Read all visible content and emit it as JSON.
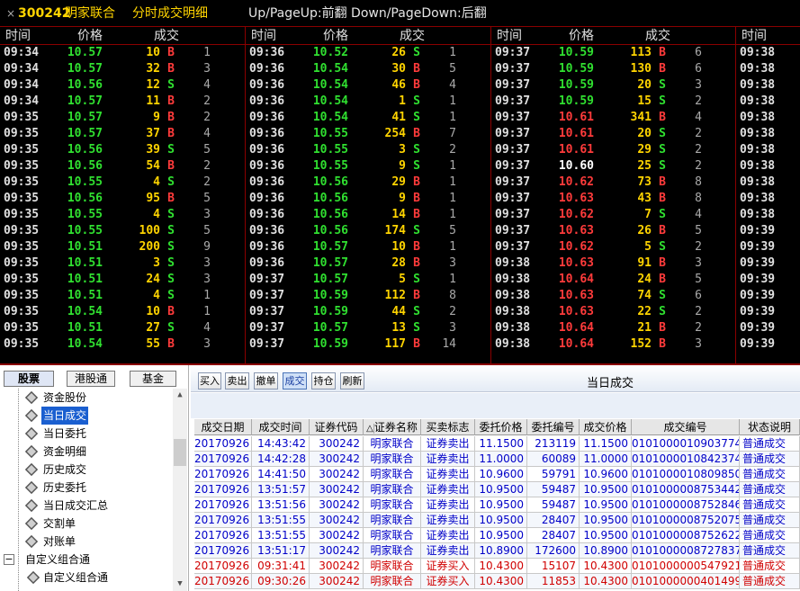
{
  "header": {
    "close": "×",
    "code": "300242",
    "name": "明家联合",
    "subtitle": "分时成交明细",
    "hint": "Up/PageUp:前翻 Down/PageDown:后翻"
  },
  "tick_headers": {
    "time": "时间",
    "price": "价格",
    "volume": "成交"
  },
  "colors": {
    "up": "#ff3b3b",
    "down": "#30e030",
    "flat": "#ffffff",
    "volume": "#ffd400",
    "border": "#8a0000"
  },
  "tick_columns": [
    [
      [
        "09:34",
        "10.57",
        "10",
        "B",
        "1",
        "dn"
      ],
      [
        "09:34",
        "10.57",
        "32",
        "B",
        "3",
        "dn"
      ],
      [
        "09:34",
        "10.56",
        "12",
        "S",
        "4",
        "dn"
      ],
      [
        "09:34",
        "10.57",
        "11",
        "B",
        "2",
        "dn"
      ],
      [
        "09:35",
        "10.57",
        "9",
        "B",
        "2",
        "dn"
      ],
      [
        "09:35",
        "10.57",
        "37",
        "B",
        "4",
        "dn"
      ],
      [
        "09:35",
        "10.56",
        "39",
        "S",
        "5",
        "dn"
      ],
      [
        "09:35",
        "10.56",
        "54",
        "B",
        "2",
        "dn"
      ],
      [
        "09:35",
        "10.55",
        "4",
        "S",
        "2",
        "dn"
      ],
      [
        "09:35",
        "10.56",
        "95",
        "B",
        "5",
        "dn"
      ],
      [
        "09:35",
        "10.55",
        "4",
        "S",
        "3",
        "dn"
      ],
      [
        "09:35",
        "10.55",
        "100",
        "S",
        "5",
        "dn"
      ],
      [
        "09:35",
        "10.51",
        "200",
        "S",
        "9",
        "dn"
      ],
      [
        "09:35",
        "10.51",
        "3",
        "S",
        "3",
        "dn"
      ],
      [
        "09:35",
        "10.51",
        "24",
        "S",
        "3",
        "dn"
      ],
      [
        "09:35",
        "10.51",
        "4",
        "S",
        "1",
        "dn"
      ],
      [
        "09:35",
        "10.54",
        "10",
        "B",
        "1",
        "dn"
      ],
      [
        "09:35",
        "10.51",
        "27",
        "S",
        "4",
        "dn"
      ],
      [
        "09:35",
        "10.54",
        "55",
        "B",
        "3",
        "dn"
      ]
    ],
    [
      [
        "09:36",
        "10.52",
        "26",
        "S",
        "1",
        "dn"
      ],
      [
        "09:36",
        "10.54",
        "30",
        "B",
        "5",
        "dn"
      ],
      [
        "09:36",
        "10.54",
        "46",
        "B",
        "4",
        "dn"
      ],
      [
        "09:36",
        "10.54",
        "1",
        "S",
        "1",
        "dn"
      ],
      [
        "09:36",
        "10.54",
        "41",
        "S",
        "1",
        "dn"
      ],
      [
        "09:36",
        "10.55",
        "254",
        "B",
        "7",
        "dn"
      ],
      [
        "09:36",
        "10.55",
        "3",
        "S",
        "2",
        "dn"
      ],
      [
        "09:36",
        "10.55",
        "9",
        "S",
        "1",
        "dn"
      ],
      [
        "09:36",
        "10.56",
        "29",
        "B",
        "1",
        "dn"
      ],
      [
        "09:36",
        "10.56",
        "9",
        "B",
        "1",
        "dn"
      ],
      [
        "09:36",
        "10.56",
        "14",
        "B",
        "1",
        "dn"
      ],
      [
        "09:36",
        "10.56",
        "174",
        "S",
        "5",
        "dn"
      ],
      [
        "09:36",
        "10.57",
        "10",
        "B",
        "1",
        "dn"
      ],
      [
        "09:36",
        "10.57",
        "28",
        "B",
        "3",
        "dn"
      ],
      [
        "09:37",
        "10.57",
        "5",
        "S",
        "1",
        "dn"
      ],
      [
        "09:37",
        "10.59",
        "112",
        "B",
        "8",
        "dn"
      ],
      [
        "09:37",
        "10.59",
        "44",
        "S",
        "2",
        "dn"
      ],
      [
        "09:37",
        "10.57",
        "13",
        "S",
        "3",
        "dn"
      ],
      [
        "09:37",
        "10.59",
        "117",
        "B",
        "14",
        "dn"
      ]
    ],
    [
      [
        "09:37",
        "10.59",
        "113",
        "B",
        "6",
        "dn"
      ],
      [
        "09:37",
        "10.59",
        "130",
        "B",
        "6",
        "dn"
      ],
      [
        "09:37",
        "10.59",
        "20",
        "S",
        "3",
        "dn"
      ],
      [
        "09:37",
        "10.59",
        "15",
        "S",
        "2",
        "dn"
      ],
      [
        "09:37",
        "10.61",
        "341",
        "B",
        "4",
        "up"
      ],
      [
        "09:37",
        "10.61",
        "20",
        "S",
        "2",
        "up"
      ],
      [
        "09:37",
        "10.61",
        "29",
        "S",
        "2",
        "up"
      ],
      [
        "09:37",
        "10.60",
        "25",
        "S",
        "2",
        "eq"
      ],
      [
        "09:37",
        "10.62",
        "73",
        "B",
        "8",
        "up"
      ],
      [
        "09:37",
        "10.63",
        "43",
        "B",
        "8",
        "up"
      ],
      [
        "09:37",
        "10.62",
        "7",
        "S",
        "4",
        "up"
      ],
      [
        "09:37",
        "10.63",
        "26",
        "B",
        "5",
        "up"
      ],
      [
        "09:37",
        "10.62",
        "5",
        "S",
        "2",
        "up"
      ],
      [
        "09:38",
        "10.63",
        "91",
        "B",
        "3",
        "up"
      ],
      [
        "09:38",
        "10.64",
        "24",
        "B",
        "5",
        "up"
      ],
      [
        "09:38",
        "10.63",
        "74",
        "S",
        "6",
        "up"
      ],
      [
        "09:38",
        "10.63",
        "22",
        "S",
        "2",
        "up"
      ],
      [
        "09:38",
        "10.64",
        "21",
        "B",
        "2",
        "up"
      ],
      [
        "09:38",
        "10.64",
        "152",
        "B",
        "3",
        "up"
      ]
    ],
    [
      [
        "09:38"
      ],
      [
        "09:38"
      ],
      [
        "09:38"
      ],
      [
        "09:38"
      ],
      [
        "09:38"
      ],
      [
        "09:38"
      ],
      [
        "09:38"
      ],
      [
        "09:38"
      ],
      [
        "09:38"
      ],
      [
        "09:38"
      ],
      [
        "09:38"
      ],
      [
        "09:39"
      ],
      [
        "09:39"
      ],
      [
        "09:39"
      ],
      [
        "09:39"
      ],
      [
        "09:39"
      ],
      [
        "09:39"
      ],
      [
        "09:39"
      ],
      [
        "09:39"
      ]
    ]
  ],
  "left_tabs": [
    "股票",
    "港股通",
    "基金"
  ],
  "tree": [
    {
      "label": "资金股份"
    },
    {
      "label": "当日成交",
      "selected": true
    },
    {
      "label": "当日委托"
    },
    {
      "label": "资金明细"
    },
    {
      "label": "历史成交"
    },
    {
      "label": "历史委托"
    },
    {
      "label": "当日成交汇总"
    },
    {
      "label": "交割单"
    },
    {
      "label": "对账单"
    },
    {
      "label": "自定义组合通",
      "group": true,
      "expander": "−"
    },
    {
      "label": "自定义组合通",
      "child": true
    }
  ],
  "toolbar": {
    "buttons": [
      "买入",
      "卖出",
      "撤单",
      "成交",
      "持仓",
      "刷新"
    ],
    "active": "成交",
    "title": "当日成交"
  },
  "table": {
    "columns": [
      "成交日期",
      "成交时间",
      "证券代码",
      "证券名称",
      "买卖标志",
      "委托价格",
      "委托编号",
      "成交价格",
      "成交编号",
      "状态说明"
    ],
    "warn_mark": "△",
    "rows": [
      [
        "20170926",
        "14:43:42",
        "300242",
        "明家联合",
        "证券卖出",
        "11.1500",
        "213119",
        "11.1500",
        "0101000010903774",
        "普通成交",
        "sell"
      ],
      [
        "20170926",
        "14:42:28",
        "300242",
        "明家联合",
        "证券卖出",
        "11.0000",
        "60089",
        "11.0000",
        "0101000010842374",
        "普通成交",
        "sell"
      ],
      [
        "20170926",
        "14:41:50",
        "300242",
        "明家联合",
        "证券卖出",
        "10.9600",
        "59791",
        "10.9600",
        "0101000010809850",
        "普通成交",
        "sell"
      ],
      [
        "20170926",
        "13:51:57",
        "300242",
        "明家联合",
        "证券卖出",
        "10.9500",
        "59487",
        "10.9500",
        "0101000008753442",
        "普通成交",
        "sell"
      ],
      [
        "20170926",
        "13:51:56",
        "300242",
        "明家联合",
        "证券卖出",
        "10.9500",
        "59487",
        "10.9500",
        "0101000008752846",
        "普通成交",
        "sell"
      ],
      [
        "20170926",
        "13:51:55",
        "300242",
        "明家联合",
        "证券卖出",
        "10.9500",
        "28407",
        "10.9500",
        "0101000008752075",
        "普通成交",
        "sell"
      ],
      [
        "20170926",
        "13:51:55",
        "300242",
        "明家联合",
        "证券卖出",
        "10.9500",
        "28407",
        "10.9500",
        "0101000008752622",
        "普通成交",
        "sell"
      ],
      [
        "20170926",
        "13:51:17",
        "300242",
        "明家联合",
        "证券卖出",
        "10.8900",
        "172600",
        "10.8900",
        "0101000008727837",
        "普通成交",
        "sell"
      ],
      [
        "20170926",
        "09:31:41",
        "300242",
        "明家联合",
        "证券买入",
        "10.4300",
        "15107",
        "10.4300",
        "0101000000547921",
        "普通成交",
        "buy"
      ],
      [
        "20170926",
        "09:30:26",
        "300242",
        "明家联合",
        "证券买入",
        "10.4300",
        "11853",
        "10.4300",
        "0101000000401499",
        "普通成交",
        "buy"
      ]
    ]
  }
}
